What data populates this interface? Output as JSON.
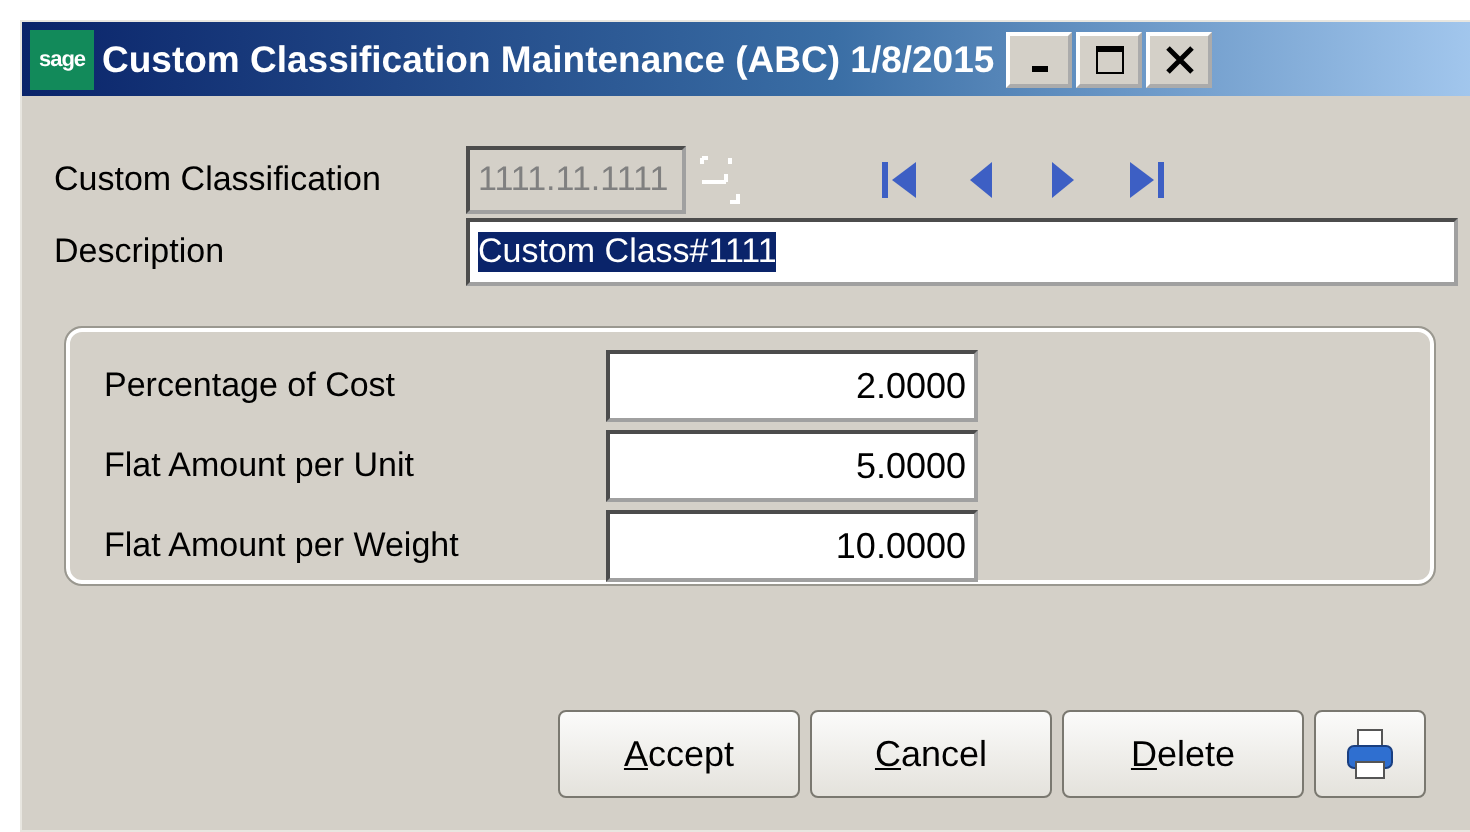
{
  "window": {
    "logo": "sage",
    "title": "Custom Classification Maintenance (ABC) 1/8/2015",
    "controls": [
      {
        "kind": "minimize"
      },
      {
        "kind": "maximize"
      },
      {
        "kind": "close"
      }
    ]
  },
  "header": {
    "classification_label": "Custom Classification",
    "classification_value": "1111.11.1111",
    "classification_disabled": true,
    "nav": [
      {
        "kind": "first"
      },
      {
        "kind": "previous"
      },
      {
        "kind": "next"
      },
      {
        "kind": "last"
      }
    ],
    "description_label": "Description",
    "description_value": "Custom Class#1111",
    "description_selected": true
  },
  "rates": [
    {
      "label": "Percentage of Cost",
      "value": "2.0000"
    },
    {
      "label": "Flat Amount per Unit",
      "value": "5.0000"
    },
    {
      "label": "Flat Amount per Weight",
      "value": "10.0000"
    }
  ],
  "buttons": [
    {
      "kind": "text",
      "mnemonic": "A",
      "rest": "ccept"
    },
    {
      "kind": "text",
      "mnemonic": "C",
      "rest": "ancel"
    },
    {
      "kind": "text",
      "mnemonic": "D",
      "rest": "elete"
    },
    {
      "kind": "print"
    }
  ]
}
